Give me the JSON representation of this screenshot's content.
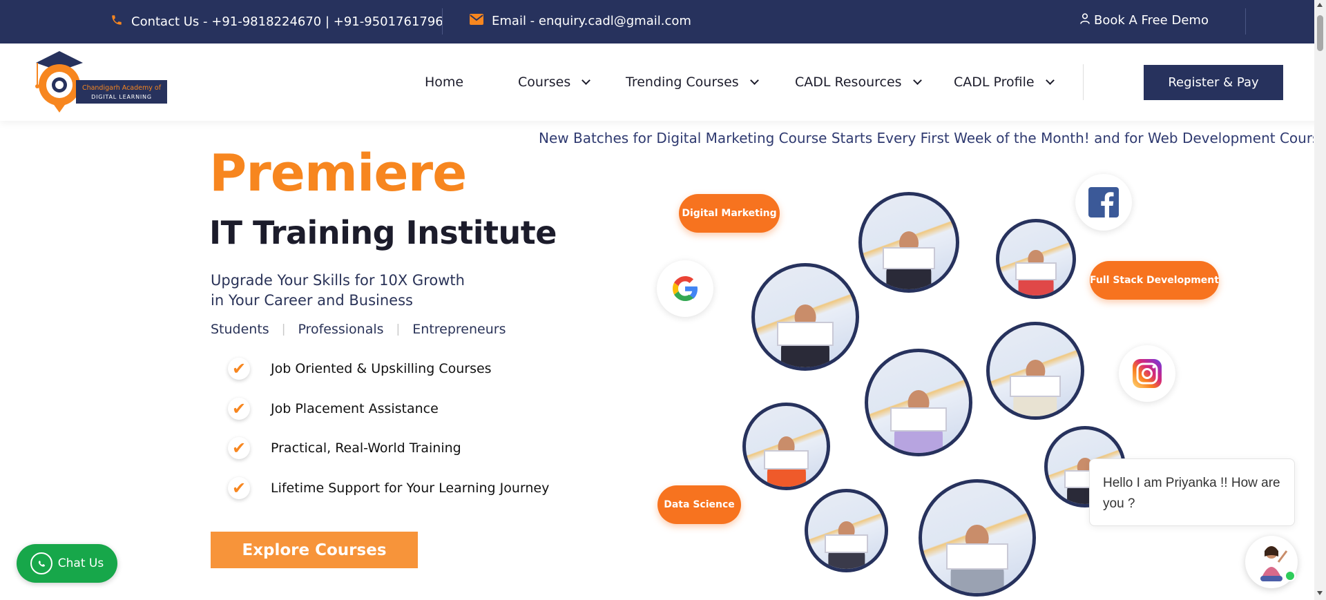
{
  "topbar": {
    "contact": "Contact Us - +91-9818224670 | +91-9501761796",
    "email": "Email - enquiry.cadl@gmail.com",
    "demo": "Book A Free Demo",
    "phone_icon": "phone-icon",
    "mail_icon": "envelope-icon",
    "user_icon": "user-icon"
  },
  "logo": {
    "line1": "Chandigarh Academy of",
    "line2": "DIGITAL LEARNING"
  },
  "nav": {
    "items": [
      {
        "label": "Home"
      },
      {
        "label": "Courses"
      },
      {
        "label": "Trending Courses"
      },
      {
        "label": "CADL Resources"
      },
      {
        "label": "CADL Profile"
      }
    ],
    "register": "Register & Pay"
  },
  "marquee": "New Batches for Digital Marketing Course Starts Every First Week of the Month! and for Web Development Course",
  "hero": {
    "title1": "Premiere",
    "title2": "IT Training Institute",
    "sub1": "Upgrade Your Skills for 10X Growth",
    "sub2": "in Your Career and Business",
    "audience": [
      "Students",
      "Professionals",
      "Entrepreneurs"
    ],
    "features": [
      "Job Oriented & Upskilling Courses",
      "Job Placement Assistance",
      "Practical, Real-World Training",
      "Lifetime Support for Your Learning Journey"
    ],
    "cta": "Explore Courses"
  },
  "pills": [
    "Digital Marketing",
    "Full Stack Development",
    "Data Science"
  ],
  "colors": {
    "navy": "#27325d",
    "orange": "#f7861f",
    "green": "#17a74a"
  },
  "chat": {
    "button": "Chat Us",
    "message": "Hello I am Priyanka !! How are you ?"
  }
}
